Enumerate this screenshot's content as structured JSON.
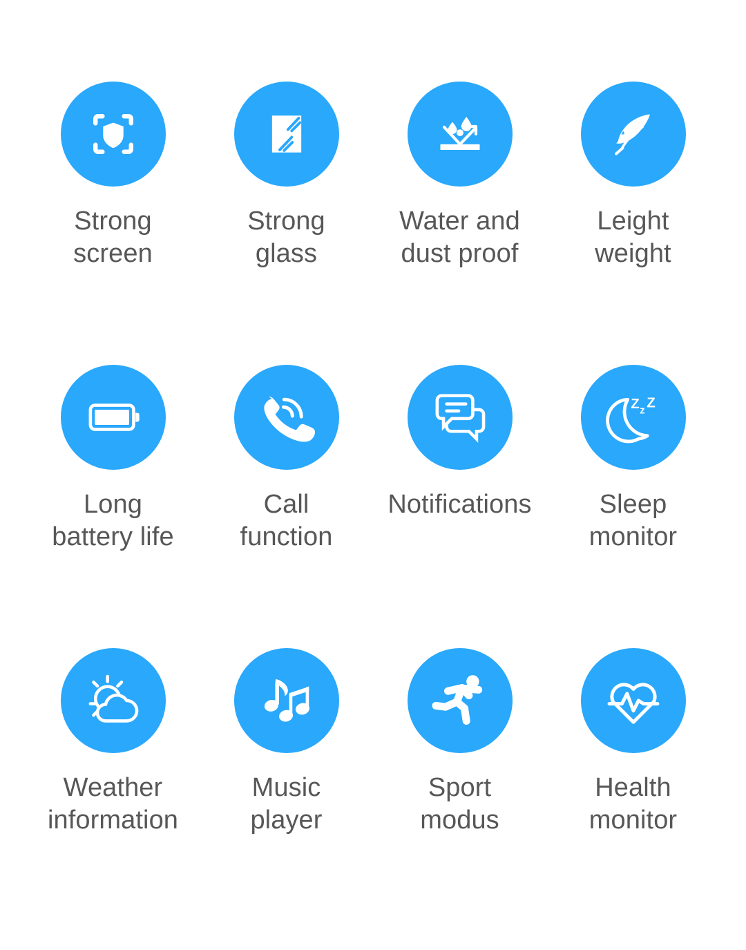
{
  "theme": {
    "background": "#ffffff",
    "accent": "#29a8fc",
    "icon_color": "#ffffff",
    "label_color": "#575757"
  },
  "features": [
    {
      "icon": "screen-shield-icon",
      "label": "Strong\nscreen"
    },
    {
      "icon": "glass-pane-icon",
      "label": "Strong\nglass"
    },
    {
      "icon": "water-repellent-icon",
      "label": "Water and\ndust proof"
    },
    {
      "icon": "feather-icon",
      "label": "Leight\nweight"
    },
    {
      "icon": "battery-icon",
      "label": "Long\nbattery life"
    },
    {
      "icon": "phone-call-icon",
      "label": "Call\nfunction"
    },
    {
      "icon": "chat-bubbles-icon",
      "label": "Notifications"
    },
    {
      "icon": "moon-zzz-icon",
      "label": "Sleep\nmonitor"
    },
    {
      "icon": "sun-cloud-icon",
      "label": "Weather\ninformation"
    },
    {
      "icon": "music-notes-icon",
      "label": "Music\nplayer"
    },
    {
      "icon": "running-person-icon",
      "label": "Sport\nmodus"
    },
    {
      "icon": "heart-pulse-icon",
      "label": "Health\nmonitor"
    }
  ]
}
